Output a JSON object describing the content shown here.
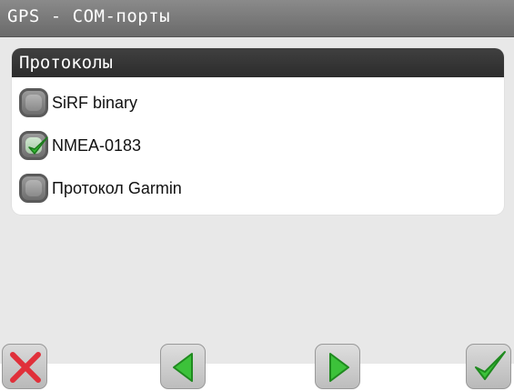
{
  "window": {
    "title": "GPS - COM-порты"
  },
  "panel": {
    "header": "Протоколы",
    "options": [
      {
        "label": "SiRF binary",
        "checked": false
      },
      {
        "label": "NMEA-0183",
        "checked": true
      },
      {
        "label": "Протокол Garmin",
        "checked": false
      }
    ]
  },
  "toolbar": {
    "buttons": [
      {
        "icon": "close-icon",
        "color": "#e0303a"
      },
      {
        "icon": "arrow-left-icon",
        "color": "#3cc23a"
      },
      {
        "icon": "arrow-right-icon",
        "color": "#3cc23a"
      },
      {
        "icon": "checkmark-icon",
        "color": "#3cc23a"
      }
    ]
  }
}
